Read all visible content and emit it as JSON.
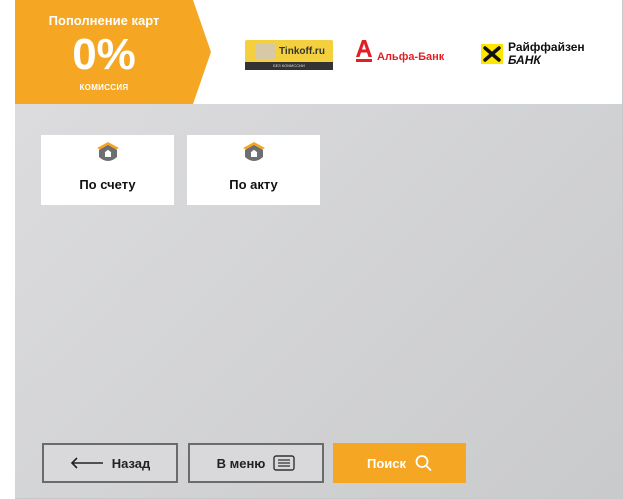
{
  "promo": {
    "title": "Пополнение карт",
    "percent": "0%",
    "subtitle": "КОМИССИЯ",
    "color": "#f5a623"
  },
  "banks": {
    "tinkoff": "Tinkoff.ru",
    "tinkoff_strip": "БЕЗ КОМИССИИ",
    "alfa": "Альфа-Банк",
    "raif_line1": "Райффайзен",
    "raif_line2": "БАНК"
  },
  "tiles": [
    {
      "label": "По счету",
      "icon": "house-icon"
    },
    {
      "label": "По акту",
      "icon": "house-icon"
    }
  ],
  "footer": {
    "back_label": "Назад",
    "menu_label": "В меню",
    "search_label": "Поиск"
  },
  "colors": {
    "accent": "#f5a623",
    "alfa_red": "#e31f26",
    "raif_yellow": "#fee600"
  }
}
